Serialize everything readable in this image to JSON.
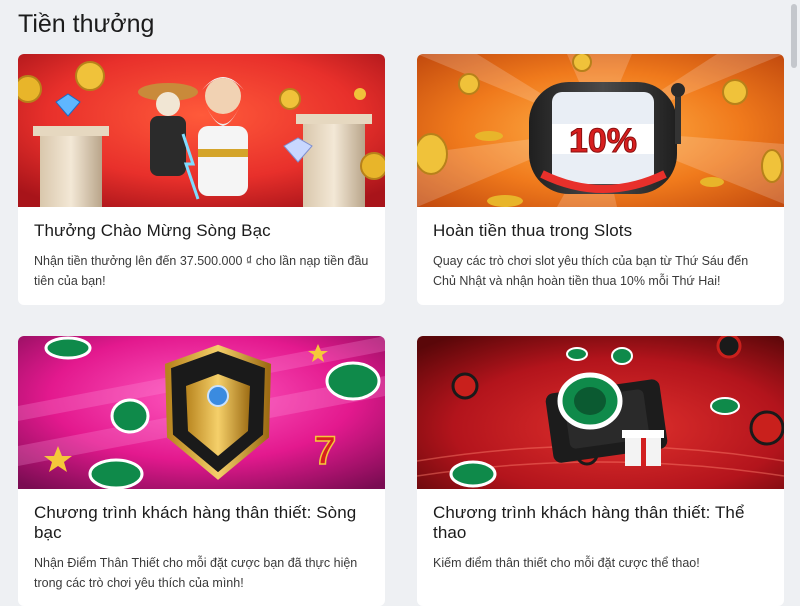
{
  "page": {
    "title": "Tiền thưởng"
  },
  "cards": [
    {
      "title": "Thưởng Chào Mừng Sòng Bạc",
      "description": "Nhận tiền thưởng lên đến 37.500.000 ₫ cho lần nạp tiền đầu tiên của bạn!",
      "banner_icon": "zeus-casino-banner"
    },
    {
      "title": "Hoàn tiền thua trong Slots",
      "description": "Quay các trò chơi slot yêu thích của bạn từ Thứ Sáu đến Chủ Nhật và nhận hoàn tiền thua 10% mỗi Thứ Hai!",
      "banner_icon": "slot-cashback-banner",
      "banner_text": "10%"
    },
    {
      "title": "Chương trình khách hàng thân thiết: Sòng bạc",
      "description": "Nhận Điểm Thân Thiết cho mỗi đặt cược bạn đã thực hiện trong các trò chơi yêu thích của mình!",
      "banner_icon": "loyalty-casino-banner"
    },
    {
      "title": "Chương trình khách hàng thân thiết: Thể thao",
      "description": "Kiếm điểm thân thiết cho mỗi đặt cược thể thao!",
      "banner_icon": "loyalty-sports-banner"
    }
  ],
  "colors": {
    "background": "#eef0f3",
    "card": "#ffffff",
    "casino_red": "#e8302b",
    "slots_orange": "#f07a1c",
    "magenta": "#e3198e",
    "sports_red": "#b3141c",
    "chip_green": "#0f8a4a",
    "gold": "#e8b52a"
  }
}
